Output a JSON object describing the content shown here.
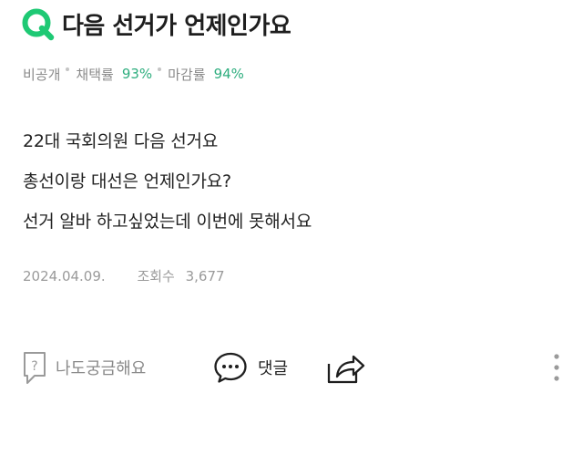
{
  "question": {
    "icon_letter": "Q",
    "title": "다음 선거가 언제인가요"
  },
  "meta": {
    "visibility": "비공개",
    "adopt_label": "채택률",
    "adopt_rate": "93%",
    "close_label": "마감률",
    "close_rate": "94%"
  },
  "body": {
    "lines": [
      "22대 국회의원 다음 선거요",
      "총선이랑 대선은 언제인가요?",
      "선거 알바 하고싶었는데 이번에 못해서요"
    ]
  },
  "info": {
    "date": "2024.04.09.",
    "views_label": "조회수",
    "views_count": "3,677"
  },
  "actions": {
    "curious_label": "나도궁금해요",
    "comment_label": "댓글"
  },
  "colors": {
    "accent_green": "#2fae7f",
    "brand_green": "#1ec974",
    "text_dark": "#1e1e1e",
    "text_gray": "#8a8a8a"
  },
  "icons": {
    "q_logo": "q-logo-icon",
    "curious": "question-box-icon",
    "comment": "speech-bubble-icon",
    "share": "share-icon",
    "more": "more-vertical-icon"
  }
}
